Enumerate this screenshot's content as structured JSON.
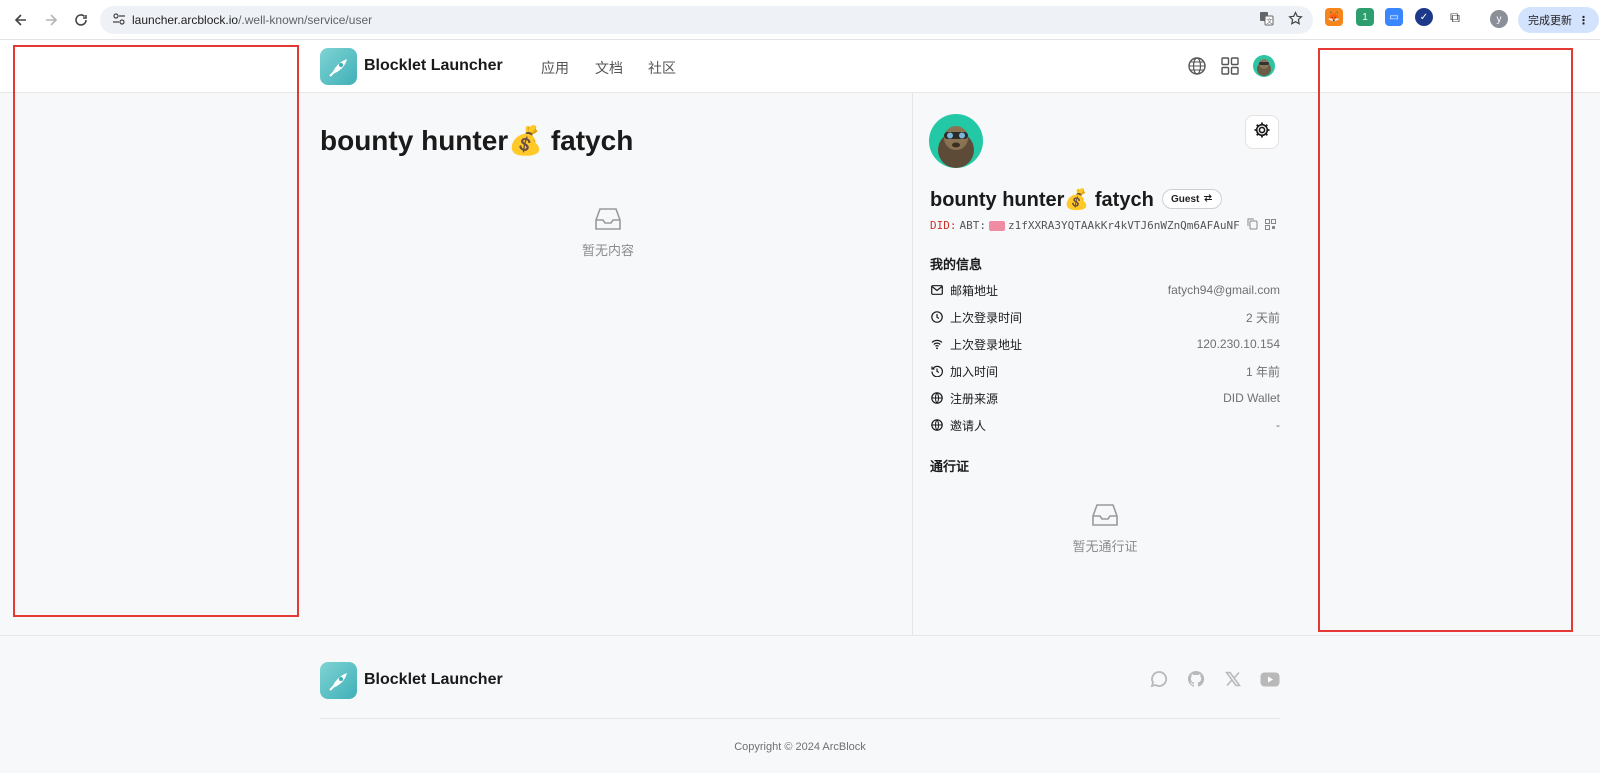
{
  "browser": {
    "url_host": "launcher.arcblock.io",
    "url_path": "/.well-known/service/user",
    "profile_initial": "y",
    "update_label": "完成更新",
    "extension_badge": "1"
  },
  "header": {
    "brand": "Blocklet Launcher",
    "nav": [
      "应用",
      "文档",
      "社区"
    ]
  },
  "main": {
    "title": "bounty hunter💰 fatych",
    "empty_text": "暂无内容"
  },
  "profile": {
    "name": "bounty hunter💰 fatych",
    "role_badge": "Guest",
    "did_prefix": "DID:",
    "did_chain": "ABT:",
    "did_value": "z1fXXRA3YQTAAkKr4kVTJ6nWZnQm6AFAuNF",
    "info_title": "我的信息",
    "info": [
      {
        "icon": "mail-icon",
        "label": "邮箱地址",
        "value": "fatych94@gmail.com"
      },
      {
        "icon": "clock-icon",
        "label": "上次登录时间",
        "value": "2 天前"
      },
      {
        "icon": "wifi-icon",
        "label": "上次登录地址",
        "value": "120.230.10.154"
      },
      {
        "icon": "history-icon",
        "label": "加入时间",
        "value": "1 年前"
      },
      {
        "icon": "globe-icon",
        "label": "注册来源",
        "value": "DID Wallet"
      },
      {
        "icon": "globe-icon",
        "label": "邀请人",
        "value": "-"
      }
    ],
    "passport_title": "通行证",
    "passport_empty": "暂无通行证"
  },
  "footer": {
    "brand": "Blocklet Launcher",
    "copyright": "Copyright © 2024 ArcBlock"
  },
  "colors": {
    "accent_teal": "#3fb0b8",
    "avatar_green": "#23c9a6",
    "did_red": "#d0312d",
    "annotation_red": "#e53935"
  }
}
